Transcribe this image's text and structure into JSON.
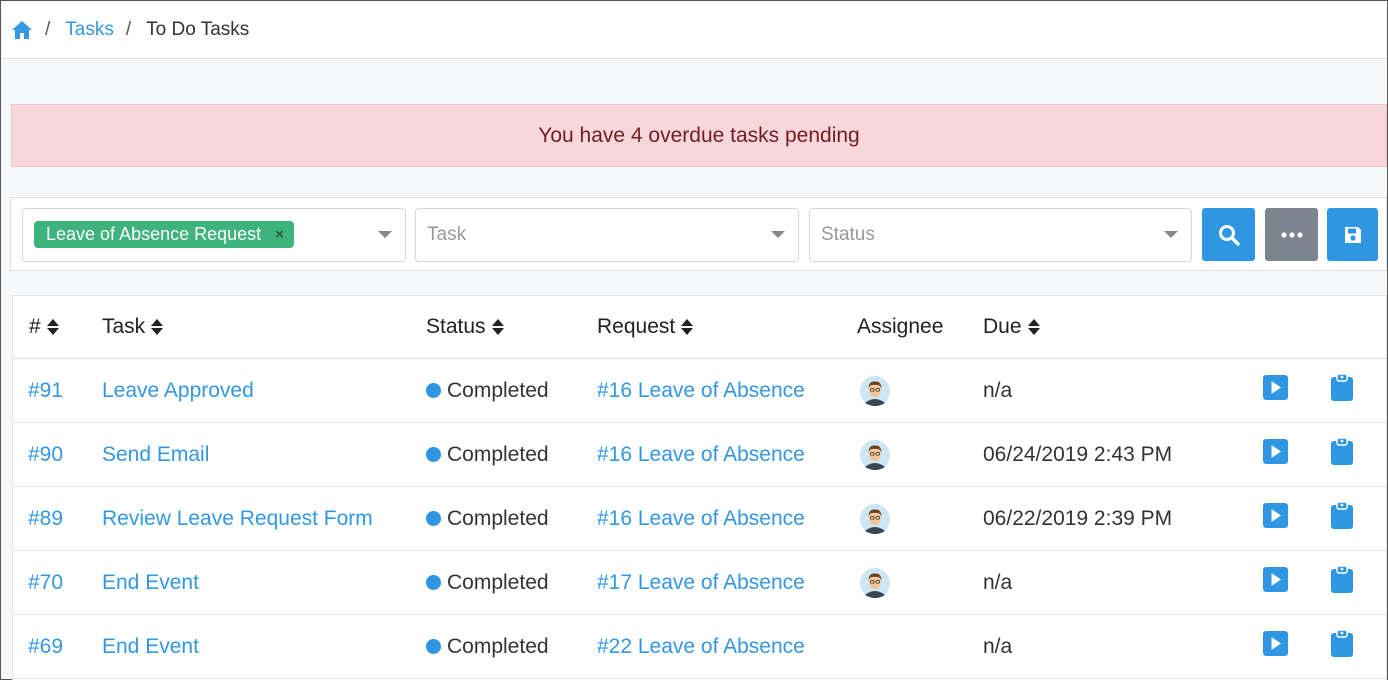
{
  "breadcrumb": {
    "home_icon": "home-icon",
    "items": [
      {
        "label": "Tasks",
        "link": true
      },
      {
        "label": "To Do Tasks",
        "link": false
      }
    ],
    "separator": "/"
  },
  "alert": {
    "text": "You have 4 overdue tasks pending"
  },
  "filters": {
    "process_tag": "Leave of Absence Request",
    "process_tag_remove": "×",
    "task_placeholder": "Task",
    "status_placeholder": "Status",
    "buttons": [
      {
        "icon": "search-icon",
        "color": "#2f96e3"
      },
      {
        "icon": "ellipsis-icon",
        "color": "#7c858d"
      },
      {
        "icon": "save-icon",
        "color": "#2f96e3"
      }
    ]
  },
  "table": {
    "columns": [
      "#",
      "Task",
      "Status",
      "Request",
      "Assignee",
      "Due"
    ],
    "rows": [
      {
        "id": "#91",
        "task": "Leave Approved",
        "status": "Completed",
        "request": "#16 Leave of Absence",
        "assignee": true,
        "due": "n/a"
      },
      {
        "id": "#90",
        "task": "Send Email",
        "status": "Completed",
        "request": "#16 Leave of Absence",
        "assignee": true,
        "due": "06/24/2019 2:43 PM"
      },
      {
        "id": "#89",
        "task": "Review Leave Request Form",
        "status": "Completed",
        "request": "#16 Leave of Absence",
        "assignee": true,
        "due": "06/22/2019 2:39 PM"
      },
      {
        "id": "#70",
        "task": "End Event",
        "status": "Completed",
        "request": "#17 Leave of Absence",
        "assignee": true,
        "due": "n/a"
      },
      {
        "id": "#69",
        "task": "End Event",
        "status": "Completed",
        "request": "#22 Leave of Absence",
        "assignee": false,
        "due": "n/a"
      }
    ],
    "row_actions": [
      "open-icon",
      "clipboard-icon"
    ]
  },
  "colors": {
    "accent": "#2f96e3",
    "link": "#3397e2",
    "tag_green": "#3eb37b",
    "alert_bg": "#f8d7da",
    "alert_text": "#721c24",
    "status_completed": "#2f96e3"
  }
}
